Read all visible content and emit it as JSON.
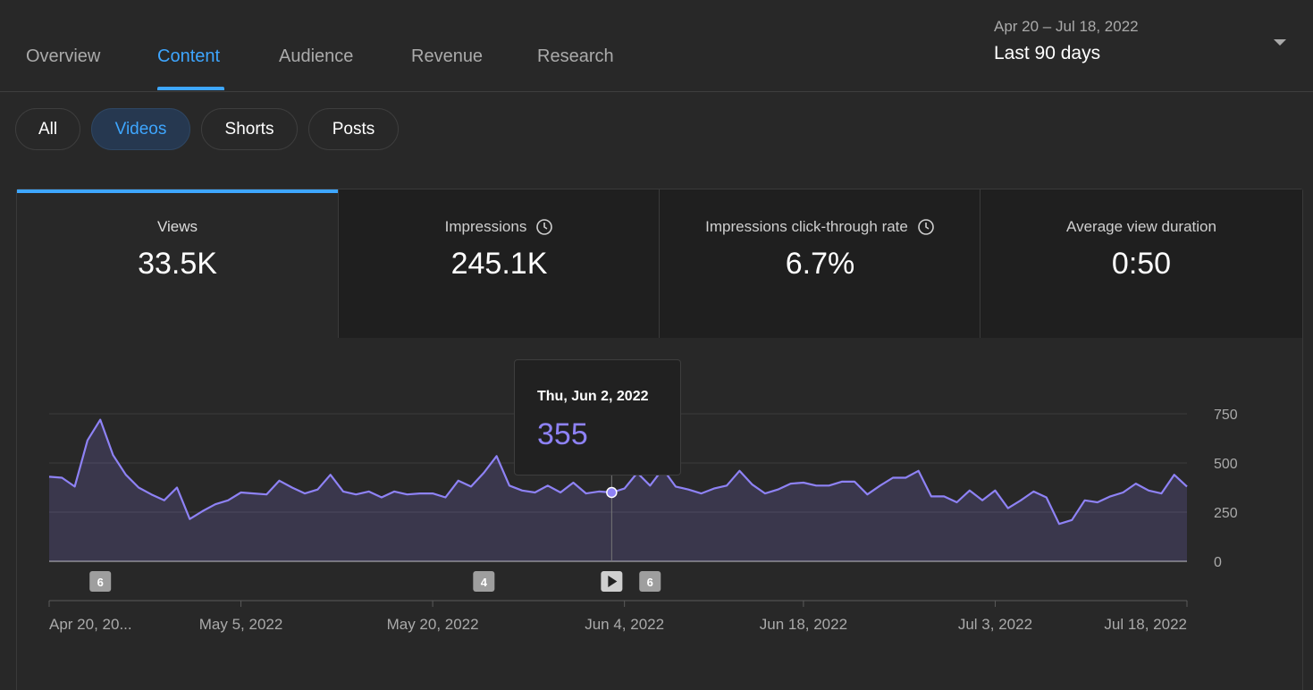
{
  "tabs": [
    {
      "label": "Overview"
    },
    {
      "label": "Content"
    },
    {
      "label": "Audience"
    },
    {
      "label": "Revenue"
    },
    {
      "label": "Research"
    }
  ],
  "date_range": {
    "range_text": "Apr 20 – Jul 18, 2022",
    "preset_label": "Last 90 days"
  },
  "chips": [
    {
      "label": "All"
    },
    {
      "label": "Videos"
    },
    {
      "label": "Shorts"
    },
    {
      "label": "Posts"
    }
  ],
  "active_chip": "Videos",
  "metrics": [
    {
      "label": "Views",
      "value": "33.5K",
      "has_info_icon": false
    },
    {
      "label": "Impressions",
      "value": "245.1K",
      "has_info_icon": true
    },
    {
      "label": "Impressions click-through rate",
      "value": "6.7%",
      "has_info_icon": true
    },
    {
      "label": "Average view duration",
      "value": "0:50",
      "has_info_icon": false
    }
  ],
  "active_metric": "Views",
  "tooltip": {
    "date": "Thu, Jun 2, 2022",
    "value": "355"
  },
  "colors": {
    "accent_blue": "#3ea6ff",
    "line_purple": "#8e82f5",
    "background": "#282828"
  },
  "chart_data": {
    "type": "area",
    "ylim": [
      0,
      750
    ],
    "yticks": [
      "750",
      "500",
      "250",
      "0"
    ],
    "grid": true,
    "xtick_labels": [
      {
        "label": "Apr 20, 20...",
        "index": 0
      },
      {
        "label": "May 5, 2022",
        "index": 15
      },
      {
        "label": "May 20, 2022",
        "index": 30
      },
      {
        "label": "Jun 4, 2022",
        "index": 45
      },
      {
        "label": "Jun 18, 2022",
        "index": 59
      },
      {
        "label": "Jul 3, 2022",
        "index": 74
      },
      {
        "label": "Jul 18, 2022",
        "index": 89
      }
    ],
    "series": [
      {
        "values": [
          430,
          425,
          380,
          615,
          720,
          540,
          440,
          375,
          340,
          310,
          375,
          215,
          255,
          290,
          310,
          350,
          345,
          340,
          410,
          375,
          345,
          365,
          440,
          355,
          340,
          355,
          325,
          355,
          340,
          345,
          345,
          325,
          410,
          380,
          450,
          535,
          385,
          360,
          350,
          385,
          350,
          400,
          345,
          355,
          350,
          370,
          450,
          385,
          470,
          380,
          365,
          345,
          370,
          385,
          460,
          390,
          345,
          365,
          395,
          400,
          385,
          385,
          405,
          405,
          340,
          385,
          425,
          425,
          460,
          330,
          330,
          300,
          360,
          310,
          360,
          270,
          310,
          355,
          325,
          190,
          210,
          310,
          300,
          330,
          350,
          395,
          360,
          345,
          440,
          380
        ]
      }
    ],
    "hover_index": 44,
    "annotations": [
      {
        "label": "6",
        "index": 4,
        "type": "count"
      },
      {
        "label": "4",
        "index": 34,
        "type": "count"
      },
      {
        "label": "",
        "index": 44,
        "type": "play"
      },
      {
        "label": "6",
        "index": 47,
        "type": "count"
      }
    ]
  }
}
